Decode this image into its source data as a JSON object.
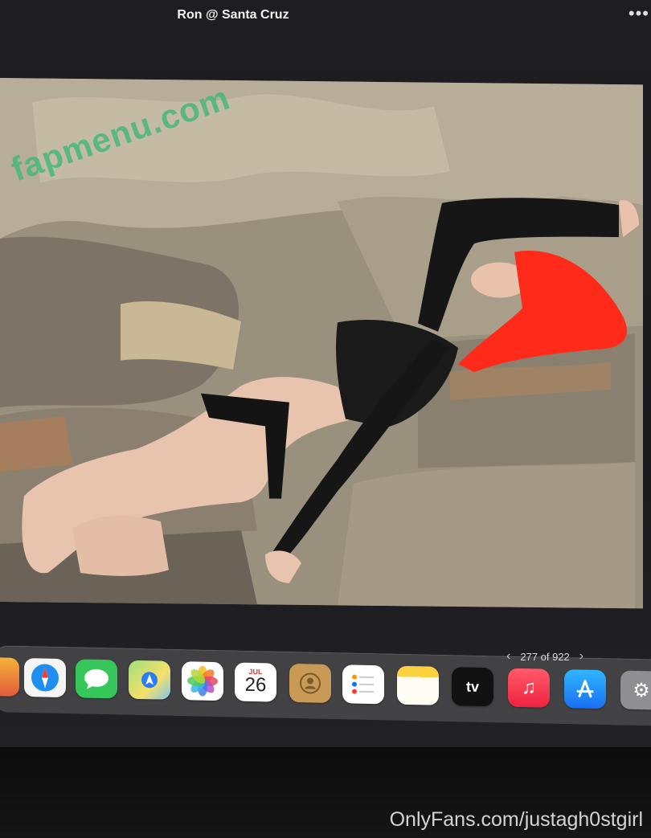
{
  "window": {
    "title": "Ron @ Santa Cruz",
    "more_icon": "ellipsis-icon"
  },
  "watermarks": {
    "top": "fapmenu.com",
    "bottom": "OnlyFans.com/justagh0stgirl"
  },
  "pager": {
    "current": "277 of 922",
    "prev_icon": "chevron-left-icon",
    "next_icon": "chevron-right-icon"
  },
  "dock": {
    "calendar": {
      "month": "JUL",
      "day": "26"
    },
    "appletv_label": "tv",
    "apps": [
      "Safari",
      "Messages",
      "Maps",
      "Photos",
      "Calendar",
      "Contacts",
      "Reminders",
      "Notes",
      "TV",
      "Music",
      "App Store",
      "System Settings"
    ]
  },
  "colors": {
    "watermark_green": "#45b87a",
    "hair_red": "#ff2a1a",
    "screen_bg": "#1c1c1f"
  }
}
